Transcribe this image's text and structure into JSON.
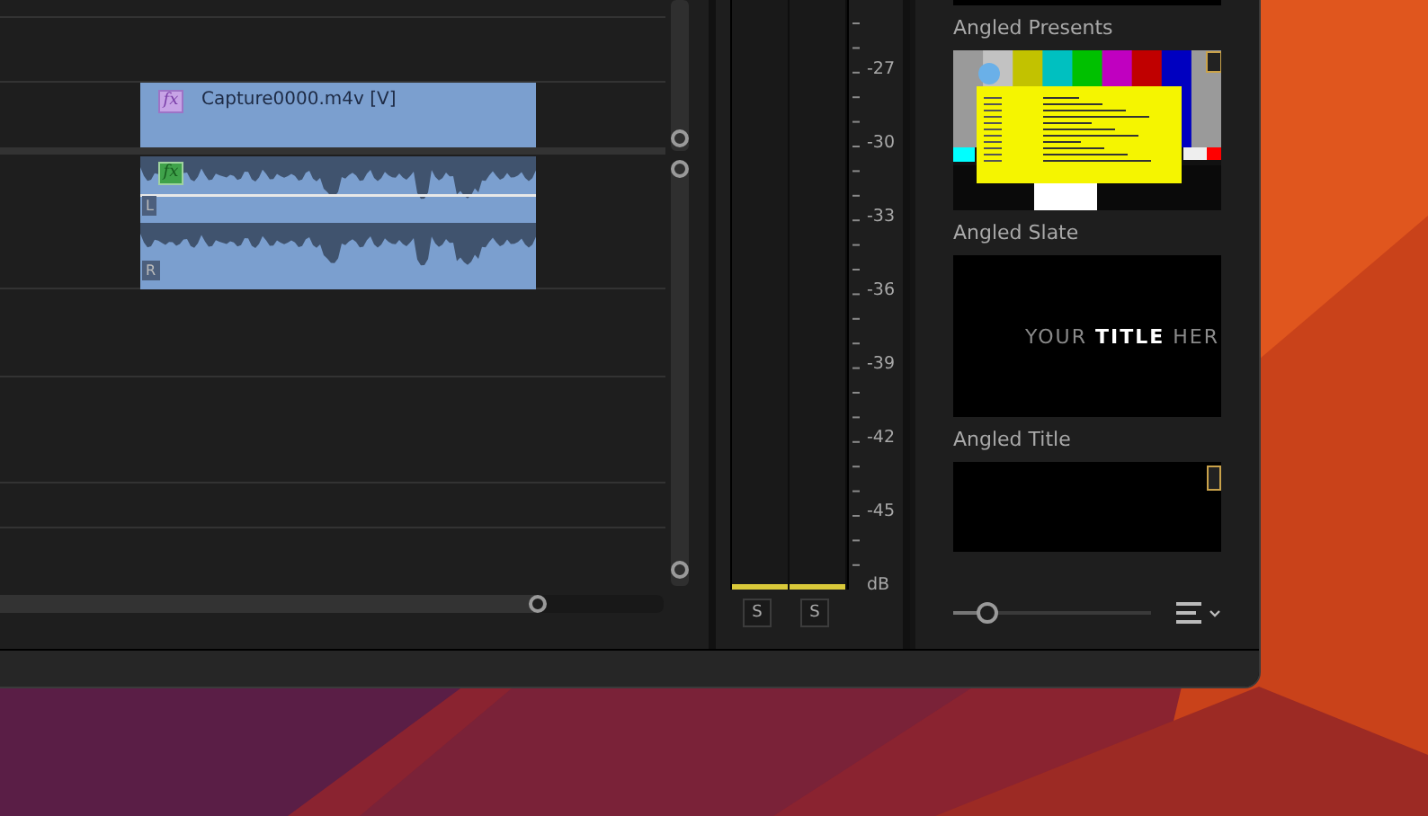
{
  "timeline": {
    "clips": [
      {
        "kind": "video",
        "fx": "fx",
        "label": "Capture0000.m4v [V]"
      },
      {
        "kind": "audio",
        "fx": "fx",
        "channels": [
          "L",
          "R"
        ]
      }
    ]
  },
  "audio_meter": {
    "scale": [
      "-27",
      "-30",
      "-33",
      "-36",
      "-39",
      "-42",
      "-45",
      "dB"
    ],
    "channels": [
      {
        "level": 0.01,
        "solo": "S"
      },
      {
        "level": 0.01,
        "solo": "S"
      }
    ]
  },
  "graphics": {
    "items": [
      {
        "kind": "black",
        "title": "Angled Presents"
      },
      {
        "kind": "slate",
        "title": "Angled Slate"
      },
      {
        "kind": "title",
        "text": "YOUR **TITLE** HER",
        "title": "Angled Title"
      },
      {
        "kind": "black-badge"
      }
    ],
    "zoom": {
      "level": 0.17
    }
  }
}
